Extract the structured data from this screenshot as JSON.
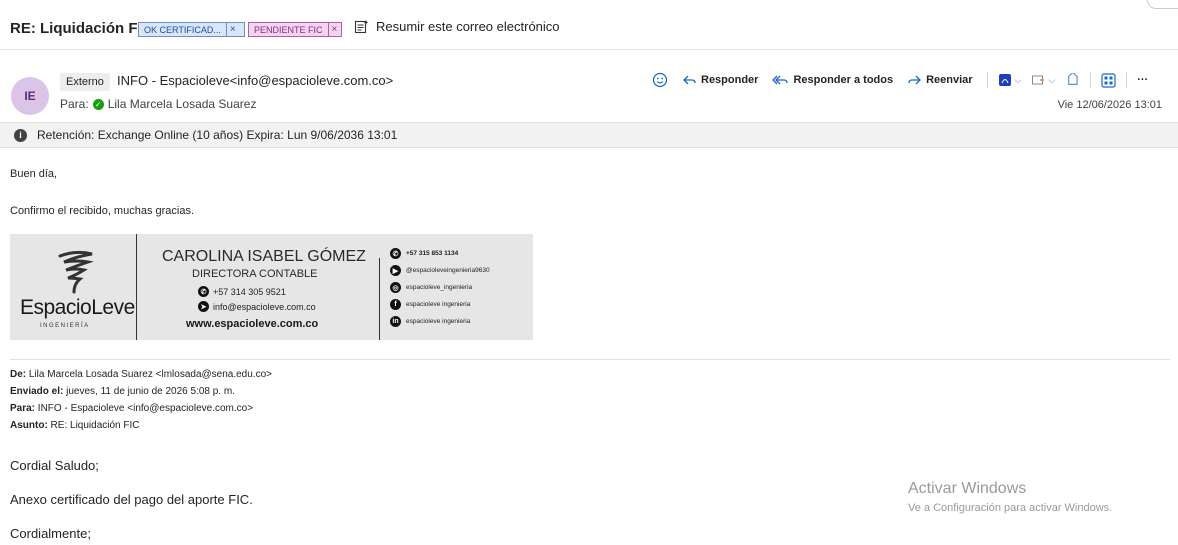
{
  "subject": {
    "title": "RE: Liquidación FIC",
    "tags": [
      {
        "label": "OK CERTIFICAD...",
        "close": "×"
      },
      {
        "label": "PENDIENTE FIC",
        "close": "×"
      }
    ],
    "summarize_label": "Resumir este correo electrónico"
  },
  "header": {
    "avatar_initials": "IE",
    "external_badge": "Externo",
    "sender": "INFO - Espacioleve<info@espacioleve.com.co>",
    "to_label": "Para:",
    "to_name": "Lila Marcela Losada Suarez",
    "date": "Vie 12/06/2026 13:01",
    "actions": {
      "reply": "Responder",
      "reply_all": "Responder a todos",
      "forward": "Reenviar",
      "more": "···"
    }
  },
  "retention": {
    "text": "Retención: Exchange Online (10 años) Expira: Lun 9/06/2036 13:01",
    "icon": "i"
  },
  "body": {
    "greeting": "Buen día,",
    "message": "Confirmo el recibido, muchas gracias."
  },
  "signature": {
    "logo_text": "EspacioLeve",
    "logo_mark": "·",
    "logo_sub": "INGENIERÍA",
    "name": "CAROLINA ISABEL GÓMEZ",
    "role": "DIRECTORA CONTABLE",
    "phone": "+57 314 305 9521",
    "email": "info@espacioleve.com.co",
    "website": "www.espacioleve.com.co",
    "social": [
      {
        "icon": "whatsapp-icon",
        "text": "+57 315 853 1134"
      },
      {
        "icon": "youtube-icon",
        "text": "@espacioleveingenieria9630"
      },
      {
        "icon": "instagram-icon",
        "text": "espacioleve_ingenieria"
      },
      {
        "icon": "facebook-icon",
        "text": "espacioleve ingenieria"
      },
      {
        "icon": "linkedin-icon",
        "text": "espacioleve ingenieria"
      }
    ]
  },
  "quoted": {
    "from_label": "De:",
    "from_value": " Lila Marcela Losada Suarez <lmlosada@sena.edu.co>",
    "sent_label": "Enviado el:",
    "sent_value": " jueves, 11 de junio de 2026 5:08 p. m.",
    "to_label": "Para:",
    "to_value": " INFO - Espacioleve <info@espacioleve.com.co>",
    "subject_label": "Asunto:",
    "subject_value": " RE: Liquidación FIC",
    "line1": "Cordial Saludo;",
    "line2": "Anexo certificado del pago del aporte FIC.",
    "line3": "Cordialmente;"
  },
  "watermark": {
    "title": "Activar Windows",
    "subtitle": "Ve a Configuración para activar Windows."
  }
}
